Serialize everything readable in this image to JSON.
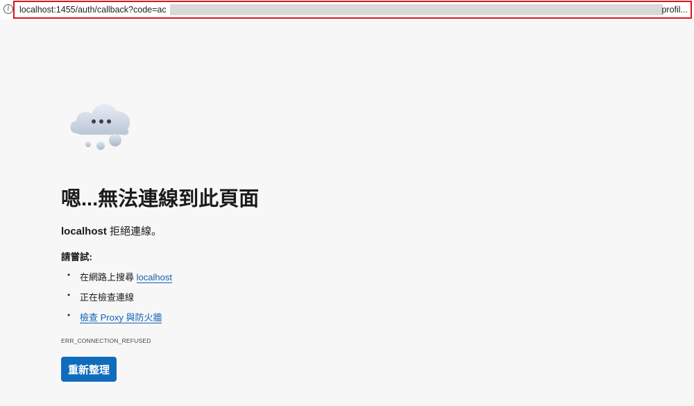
{
  "address_bar": {
    "url_prefix": "localhost:1455/auth/callback?code=ac",
    "url_suffix": "profil...",
    "info_icon": "i"
  },
  "error_page": {
    "illustration": "cloud-icon",
    "title": "嗯...無法連線到此頁面",
    "host": "localhost",
    "refused_text": " 拒絕連線。",
    "try_label": "請嘗試:",
    "suggestions": {
      "search_prefix": "在網路上搜尋 ",
      "search_link": "localhost",
      "checking": "正在檢查連線",
      "proxy_link": "檢查 Proxy 與防火牆"
    },
    "error_code": "ERR_CONNECTION_REFUSED",
    "reload_button": "重新整理"
  },
  "colors": {
    "accent": "#0f6cbd",
    "link": "#0f5fb4",
    "highlight_border": "#e0121a",
    "background": "#f7f7f7"
  }
}
